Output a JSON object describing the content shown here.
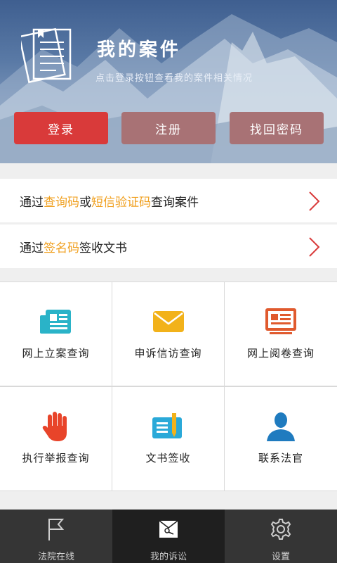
{
  "header": {
    "title": "我的案件",
    "subtitle": "点击登录按钮查看我的案件相关情况",
    "buttons": {
      "login": "登录",
      "register": "注册",
      "forgot_password": "找回密码"
    }
  },
  "list": {
    "query_case": {
      "prefix": "通过",
      "code1": "查询码",
      "or": "或",
      "code2": "短信验证码",
      "suffix": "查询案件"
    },
    "sign_docs": {
      "prefix": "通过",
      "code": "签名码",
      "suffix": "签收文书"
    }
  },
  "grid": {
    "items": [
      {
        "label": "网上立案查询",
        "icon": "newspaper-icon"
      },
      {
        "label": "申诉信访查询",
        "icon": "envelope-icon"
      },
      {
        "label": "网上阅卷查询",
        "icon": "screen-document-icon"
      },
      {
        "label": "执行举报查询",
        "icon": "hand-icon"
      },
      {
        "label": "文书签收",
        "icon": "document-pen-icon"
      },
      {
        "label": "联系法官",
        "icon": "person-icon"
      }
    ]
  },
  "tabbar": {
    "items": [
      {
        "label": "法院在线",
        "icon": "flag-icon",
        "active": false
      },
      {
        "label": "我的诉讼",
        "icon": "dossier-icon",
        "active": true
      },
      {
        "label": "设置",
        "icon": "gear-icon",
        "active": false
      }
    ]
  },
  "colors": {
    "primary_red": "#d93a3a",
    "muted_red": "#a87275",
    "highlight_orange": "#f0a020",
    "tabbar_bg": "#353535"
  }
}
